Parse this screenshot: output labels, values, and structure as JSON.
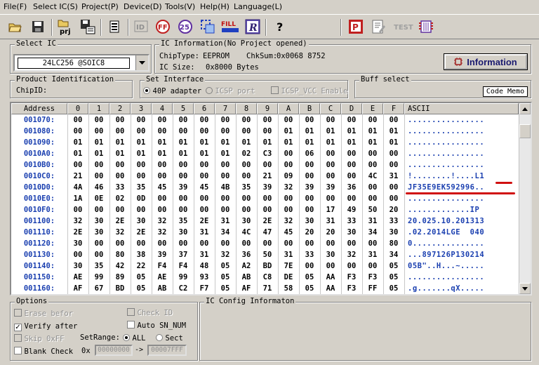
{
  "menu": [
    "File(F)",
    "Select IC(S)",
    "Project(P)",
    "Device(D)",
    "Tools(V)",
    "Help(H)",
    "Language(L)"
  ],
  "toolbar_icons": [
    "open-icon",
    "save-icon",
    "open-project-icon",
    "save-project-icon",
    "chip-icon",
    "read-id-icon",
    "erase-icon",
    "blank-check-icon",
    "select-region-icon",
    "fill-icon",
    "read-icon",
    "help-icon",
    "program-icon",
    "edit-icon",
    "test-icon",
    "chip-config-icon"
  ],
  "toolbar_labels": {
    "prj": "prj",
    "fill": "FILL",
    "read": "R",
    "help": "?",
    "program": "P",
    "test": "TEST",
    "ff": "FF",
    "id": "ID",
    "n25": "25"
  },
  "select_ic": {
    "title": "Select IC",
    "value": "24LC256 @SOIC8"
  },
  "ic_info": {
    "title": "IC Information(No Project opened)",
    "chip_type_label": "ChipType:",
    "chip_type": "EEPROM",
    "checksum_label": "ChkSum:",
    "checksum": "0x0068 8752",
    "ic_size_label": "IC Size:",
    "ic_size": "0x8000 Bytes",
    "button": "Information"
  },
  "product_id": {
    "title": "Product Identification",
    "chip_id_label": "ChipID:"
  },
  "set_interface": {
    "title": "Set Interface",
    "opt1": "40P adapter",
    "opt2": "ICSP port",
    "opt3": "ICSP_VCC Enable"
  },
  "buff_select": {
    "title": "Buff select",
    "value": "Code Memo"
  },
  "hex": {
    "headers": [
      "Address",
      "0",
      "1",
      "2",
      "3",
      "4",
      "5",
      "6",
      "7",
      "8",
      "9",
      "A",
      "B",
      "C",
      "D",
      "E",
      "F",
      "ASCII"
    ],
    "rows": [
      {
        "addr": "001070:",
        "bytes": [
          "00",
          "00",
          "00",
          "00",
          "00",
          "00",
          "00",
          "00",
          "00",
          "00",
          "00",
          "00",
          "00",
          "00",
          "00",
          "00"
        ],
        "ascii": "................"
      },
      {
        "addr": "001080:",
        "bytes": [
          "00",
          "00",
          "00",
          "00",
          "00",
          "00",
          "00",
          "00",
          "00",
          "00",
          "01",
          "01",
          "01",
          "01",
          "01",
          "01"
        ],
        "ascii": "................"
      },
      {
        "addr": "001090:",
        "bytes": [
          "01",
          "01",
          "01",
          "01",
          "01",
          "01",
          "01",
          "01",
          "01",
          "01",
          "01",
          "01",
          "01",
          "01",
          "01",
          "01"
        ],
        "ascii": "................"
      },
      {
        "addr": "0010A0:",
        "bytes": [
          "01",
          "01",
          "01",
          "01",
          "01",
          "01",
          "01",
          "01",
          "02",
          "C3",
          "00",
          "06",
          "00",
          "00",
          "00",
          "00"
        ],
        "ascii": "................"
      },
      {
        "addr": "0010B0:",
        "bytes": [
          "00",
          "00",
          "00",
          "00",
          "00",
          "00",
          "00",
          "00",
          "00",
          "00",
          "00",
          "00",
          "00",
          "00",
          "00",
          "00"
        ],
        "ascii": "................"
      },
      {
        "addr": "0010C0:",
        "bytes": [
          "21",
          "00",
          "00",
          "00",
          "00",
          "00",
          "00",
          "00",
          "00",
          "21",
          "09",
          "00",
          "00",
          "00",
          "4C",
          "31"
        ],
        "ascii": "!........!....L1"
      },
      {
        "addr": "0010D0:",
        "bytes": [
          "4A",
          "46",
          "33",
          "35",
          "45",
          "39",
          "45",
          "4B",
          "35",
          "39",
          "32",
          "39",
          "39",
          "36",
          "00",
          "00"
        ],
        "ascii": "JF35E9EK592996.."
      },
      {
        "addr": "0010E0:",
        "bytes": [
          "1A",
          "0E",
          "02",
          "0D",
          "00",
          "00",
          "00",
          "00",
          "00",
          "00",
          "00",
          "00",
          "00",
          "00",
          "00",
          "00"
        ],
        "ascii": "................"
      },
      {
        "addr": "0010F0:",
        "bytes": [
          "00",
          "00",
          "00",
          "00",
          "00",
          "00",
          "00",
          "00",
          "00",
          "00",
          "00",
          "00",
          "17",
          "49",
          "50",
          "20"
        ],
        "ascii": ".............IP "
      },
      {
        "addr": "001100:",
        "bytes": [
          "32",
          "30",
          "2E",
          "30",
          "32",
          "35",
          "2E",
          "31",
          "30",
          "2E",
          "32",
          "30",
          "31",
          "33",
          "31",
          "33"
        ],
        "ascii": "20.025.10.201313"
      },
      {
        "addr": "001110:",
        "bytes": [
          "2E",
          "30",
          "32",
          "2E",
          "32",
          "30",
          "31",
          "34",
          "4C",
          "47",
          "45",
          "20",
          "20",
          "30",
          "34",
          "30"
        ],
        "ascii": ".02.2014LGE  040"
      },
      {
        "addr": "001120:",
        "bytes": [
          "30",
          "00",
          "00",
          "00",
          "00",
          "00",
          "00",
          "00",
          "00",
          "00",
          "00",
          "00",
          "00",
          "00",
          "00",
          "80"
        ],
        "ascii": "0..............."
      },
      {
        "addr": "001130:",
        "bytes": [
          "00",
          "00",
          "80",
          "38",
          "39",
          "37",
          "31",
          "32",
          "36",
          "50",
          "31",
          "33",
          "30",
          "32",
          "31",
          "34"
        ],
        "ascii": "...897126P130214"
      },
      {
        "addr": "001140:",
        "bytes": [
          "30",
          "35",
          "42",
          "22",
          "F4",
          "F4",
          "48",
          "05",
          "A2",
          "BD",
          "7E",
          "00",
          "00",
          "00",
          "00",
          "05"
        ],
        "ascii": "05B\"..H...~....."
      },
      {
        "addr": "001150:",
        "bytes": [
          "AE",
          "99",
          "89",
          "05",
          "AE",
          "99",
          "93",
          "05",
          "AB",
          "C8",
          "DE",
          "05",
          "AA",
          "F3",
          "F3",
          "05"
        ],
        "ascii": "................"
      },
      {
        "addr": "001160:",
        "bytes": [
          "AF",
          "67",
          "BD",
          "05",
          "AB",
          "C2",
          "F7",
          "05",
          "AF",
          "71",
          "58",
          "05",
          "AA",
          "F3",
          "FF",
          "05"
        ],
        "ascii": ".g.......qX....."
      }
    ]
  },
  "options": {
    "title": "Options",
    "erase_before": "Erase befor",
    "verify_after": "Verify after",
    "skip_0xff": "Skip 0xFF",
    "blank_check": "Blank Check",
    "check_id": "Check ID",
    "auto_sn": "Auto SN_NUM",
    "set_range_label": "SetRange:",
    "range_all": "ALL",
    "range_sect": "Sect",
    "range_prefix": "0x",
    "range_from": "00000000",
    "range_arrow": "->",
    "range_to": "00007FFF"
  },
  "ic_config": {
    "title": "IC Config Informaton"
  }
}
